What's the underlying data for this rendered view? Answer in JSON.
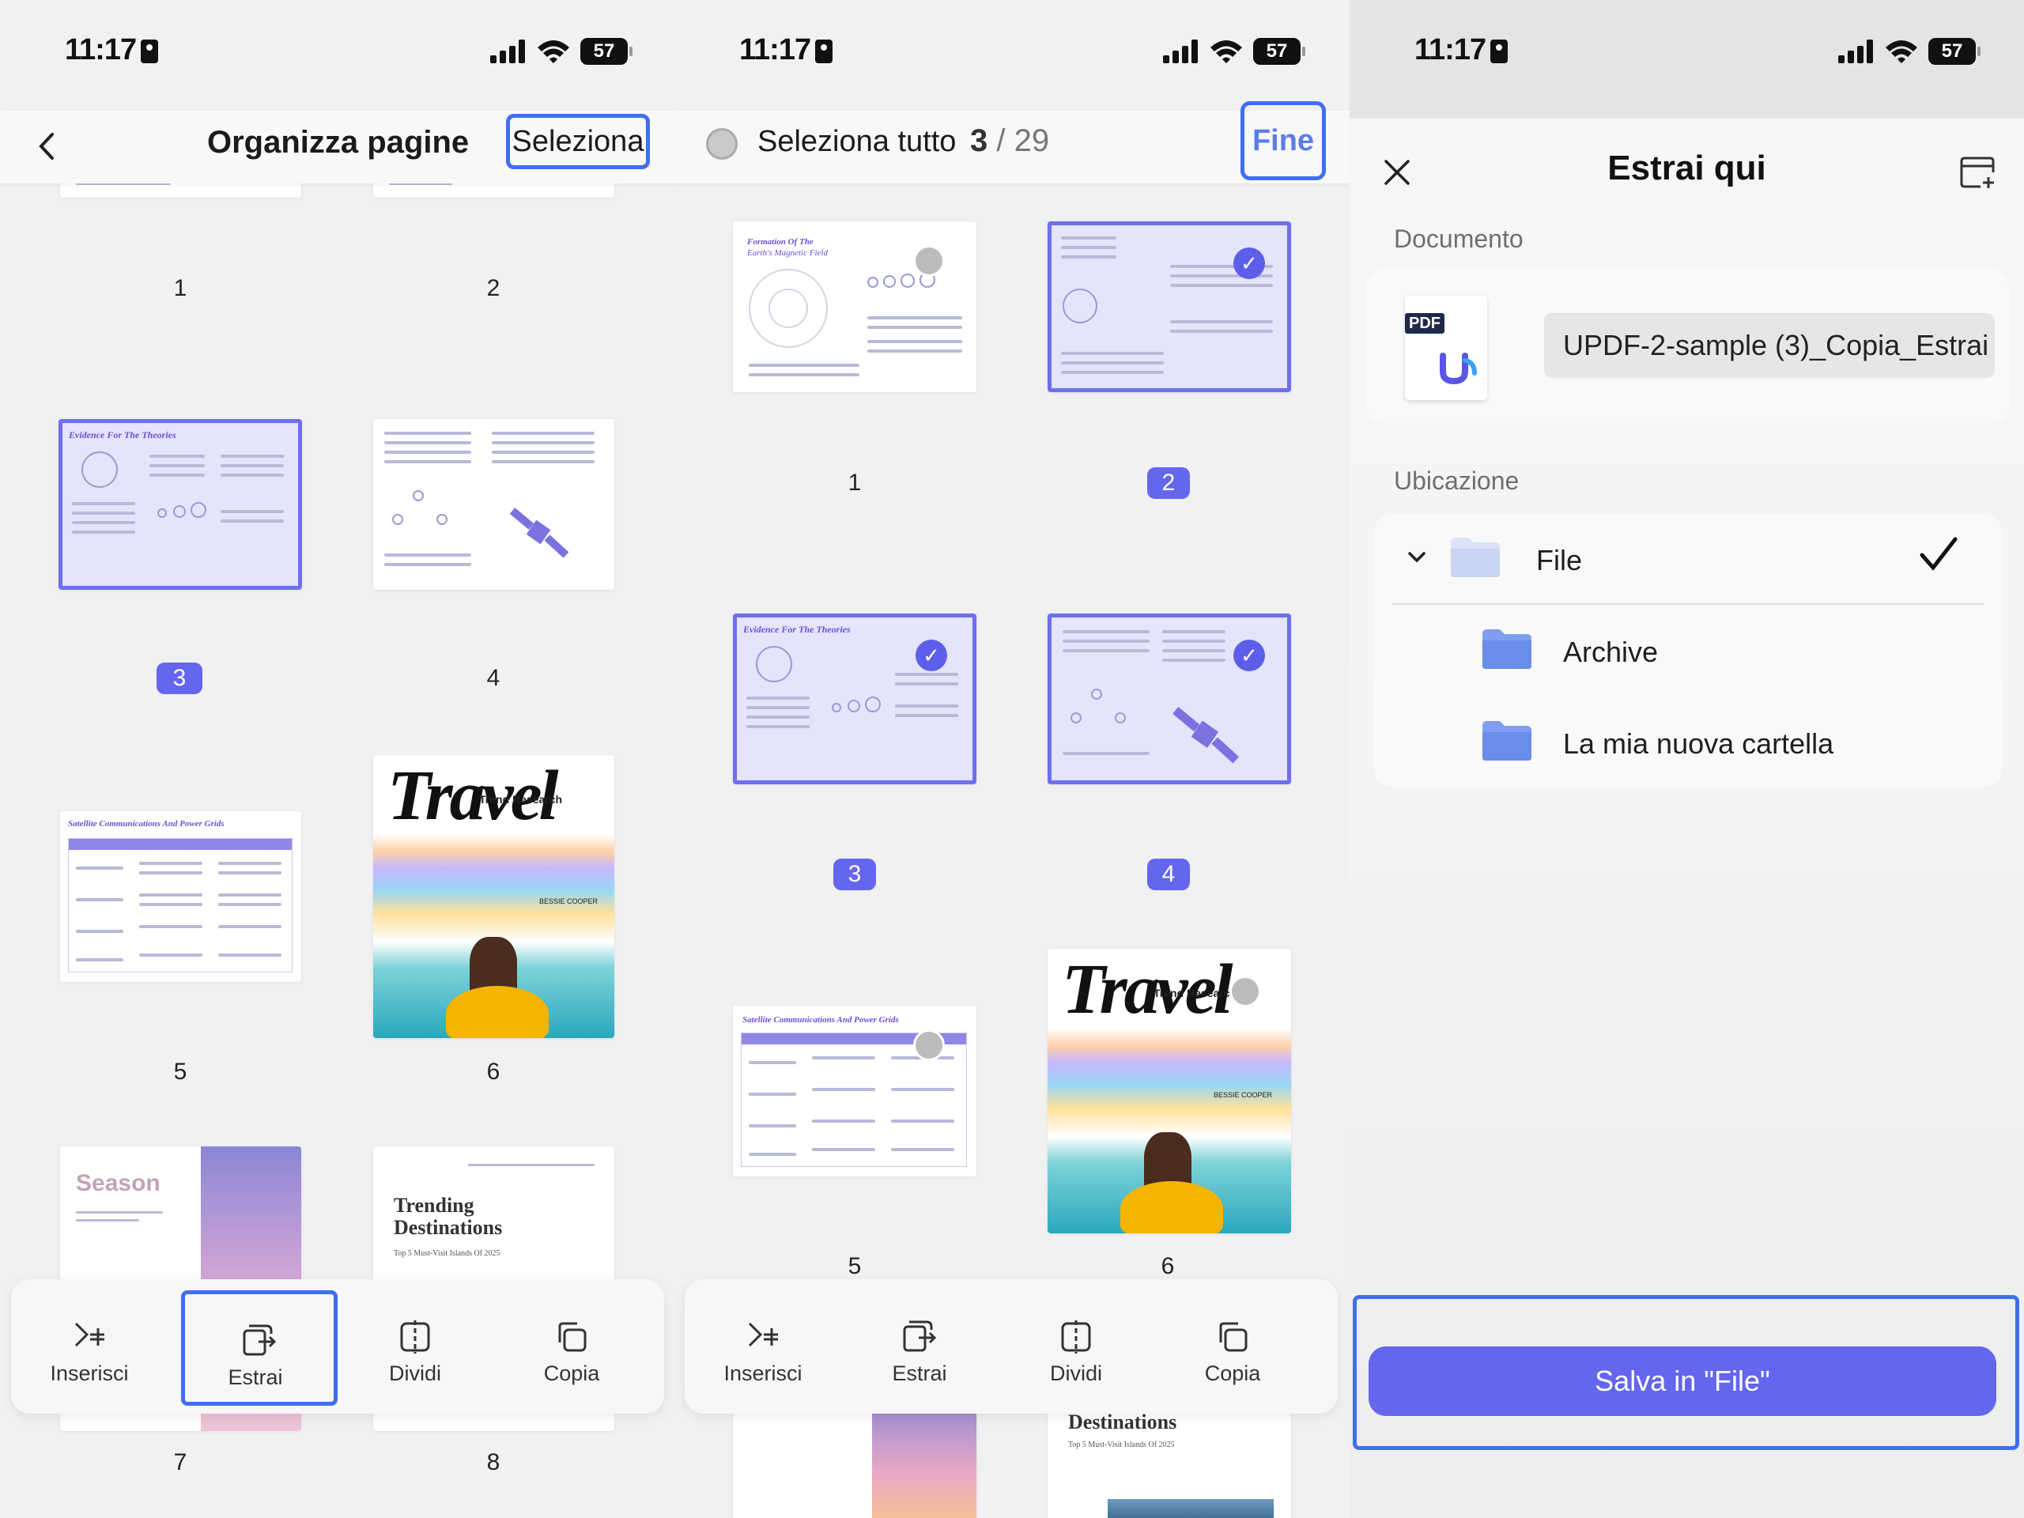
{
  "status": {
    "time": "11:17",
    "battery": "57"
  },
  "panel1": {
    "nav": {
      "title": "Organizza pagine",
      "select_label": "Seleziona"
    },
    "pages": [
      "1",
      "2",
      "3",
      "4",
      "5",
      "6",
      "7",
      "8"
    ],
    "thumb_text": {
      "p3_heading": "Evidence For The Theories",
      "p5_heading": "Satellite Communications And Power Grids",
      "p6_word": "Travel",
      "p6_sub": "Trend Research",
      "p6_author": "BESSIE COOPER",
      "p7_word": "Season",
      "p8_title_1": "Trending",
      "p8_title_2": "Destinations",
      "p8_sub": "Top 5 Must-Visit Islands Of 2025"
    },
    "toolbar": [
      "Inserisci",
      "Estrai",
      "Dividi",
      "Copia"
    ]
  },
  "panel2": {
    "nav": {
      "select_all": "Seleziona tutto",
      "count_current": "3",
      "count_total": "/ 29",
      "done": "Fine"
    },
    "pages": [
      "1",
      "2",
      "3",
      "4",
      "5",
      "6"
    ],
    "thumb_text": {
      "p1_heading_1": "Formation Of The",
      "p1_heading_2": "Earth's Magnetic Field",
      "p3_heading": "Evidence For The Theories",
      "p5_heading": "Satellite Communications And Power Grids",
      "p6_word": "Travel",
      "p6_sub": "Trend Research",
      "p6_author": "BESSIE COOPER",
      "p8_title": "Destinations",
      "p8_sub": "Top 5 Must-Visit Islands Of 2025"
    },
    "toolbar": [
      "Inserisci",
      "Estrai",
      "Dividi",
      "Copia"
    ]
  },
  "panel3": {
    "title": "Estrai qui",
    "document_label": "Documento",
    "pdf_tag": "PDF",
    "filename": "UPDF-2-sample (3)_Copia_Estrai",
    "location_label": "Ubicazione",
    "locations": [
      "File",
      "Archive",
      "La mia nuova cartella"
    ],
    "save_button": "Salva in \"File\""
  },
  "colors": {
    "accent": "#6466ee",
    "highlight": "#3f6ef0",
    "selected_bg": "#e4e4fb"
  }
}
